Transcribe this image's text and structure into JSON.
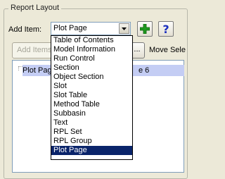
{
  "panel": {
    "title": "Report Layout"
  },
  "toolbar": {
    "add_item_label": "Add Item:",
    "selected_item": "Plot Page",
    "add_button_icon": "plus-icon",
    "help_button_icon": "question-mark-icon",
    "help_glyph": "?",
    "add_items_label": "Add Items",
    "ellipsis_label": "...",
    "move_label": "Move Sele"
  },
  "dropdown": {
    "items": [
      "Table of Contents",
      "Model Information",
      "Run Control",
      "Section",
      "Object Section",
      "Slot",
      "Slot Table",
      "Method Table",
      "Subbasin",
      "Text",
      "RPL Set",
      "RPL Group",
      "Plot Page"
    ],
    "selected_index": 12
  },
  "tree": {
    "row_label": "Plot Pag",
    "row_suffix": "e 6"
  },
  "colors": {
    "window_bg": "#ece9d8",
    "selection_bg": "#0a246a",
    "tree_selection_bg": "#c4cdf4",
    "add_icon": "#1f9a1f",
    "help_icon": "#1b2fbf"
  }
}
